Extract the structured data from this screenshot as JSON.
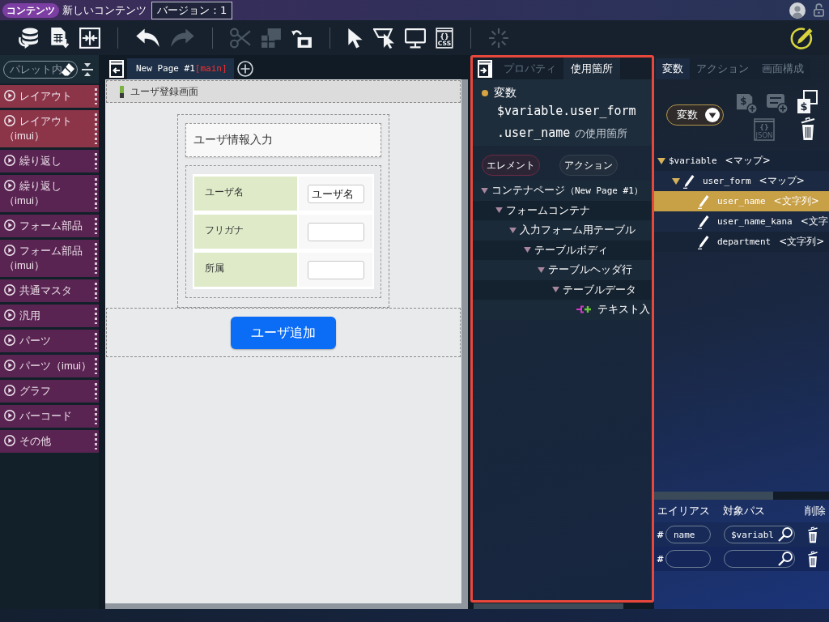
{
  "top_bar": {
    "badge": "コンテンツ",
    "title": "新しいコンテンツ",
    "version": "バージョン：1"
  },
  "toolbar": {
    "groups": [
      [
        {
          "kind": "database",
          "disabled": false
        },
        {
          "kind": "document",
          "disabled": false
        },
        {
          "kind": "split",
          "disabled": false
        }
      ],
      [
        {
          "kind": "undo",
          "disabled": false
        },
        {
          "kind": "redo",
          "disabled": true
        }
      ],
      [
        {
          "kind": "cut",
          "disabled": true
        },
        {
          "kind": "copy",
          "disabled": true
        },
        {
          "kind": "paste",
          "disabled": false
        }
      ],
      [
        {
          "kind": "pointer",
          "disabled": false
        },
        {
          "kind": "area",
          "disabled": false
        },
        {
          "kind": "preview",
          "disabled": false
        },
        {
          "kind": "css",
          "disabled": false,
          "symbol": "{}",
          "text": "CSS"
        }
      ],
      [
        {
          "kind": "spark",
          "disabled": true
        }
      ]
    ]
  },
  "palette": {
    "search": {
      "placeholder": "パレット内"
    },
    "categories": [
      {
        "label": "レイアウト",
        "color": "#8c3448"
      },
      {
        "label": "レイアウト（imui）",
        "color": "#8c3448"
      },
      {
        "label": "繰り返し",
        "color": "#5a2452"
      },
      {
        "label": "繰り返し（imui）",
        "color": "#5a2452"
      },
      {
        "label": "フォーム部品",
        "color": "#5a2452"
      },
      {
        "label": "フォーム部品（imui）",
        "color": "#5a2452"
      },
      {
        "label": "共通マスタ",
        "color": "#5a2452"
      },
      {
        "label": "汎用",
        "color": "#5a2452"
      },
      {
        "label": "パーツ",
        "color": "#5a2452"
      },
      {
        "label": "パーツ（imui）",
        "color": "#5a2452"
      },
      {
        "label": "グラフ",
        "color": "#5a2452"
      },
      {
        "label": "バーコード",
        "color": "#5a2452"
      },
      {
        "label": "その他",
        "color": "#5a2452"
      }
    ]
  },
  "canvas": {
    "tabs": [
      {
        "label": "New Page #1",
        "branch": "[main]",
        "selected": true
      }
    ],
    "page_title": "ユーザ登録画面",
    "form": {
      "title": "ユーザ情報入力",
      "rows": [
        {
          "label": "ユーザ名",
          "value": "ユーザ名"
        },
        {
          "label": "フリガナ"
        },
        {
          "label": "所属"
        }
      ]
    },
    "button": "ユーザ追加"
  },
  "usage_panel": {
    "tabs": [
      {
        "label": "プロパティ",
        "selected": false
      },
      {
        "label": "使用箇所",
        "selected": true
      }
    ],
    "target_kind": "変数",
    "path_lines": [
      "$variable.user_form",
      ".user_name"
    ],
    "suffix": "の使用箇所",
    "filters": [
      {
        "label": "エレメント",
        "selected": true
      },
      {
        "label": "アクション",
        "selected": false
      }
    ],
    "tree": [
      {
        "label": "コンテナページ",
        "note": "（New Page #1）",
        "expanded": true,
        "children": [
          {
            "label": "フォームコンテナ",
            "expanded": true,
            "children": [
              {
                "label": "入力フォーム用テーブル",
                "expanded": true,
                "children": [
                  {
                    "label": "テーブルボディ",
                    "expanded": true,
                    "children": [
                      {
                        "label": "テーブルヘッダ行",
                        "expanded": true,
                        "children": [
                          {
                            "label": "テーブルデータ",
                            "expanded": true,
                            "children": [
                              {
                                "label": "テキスト入"
                              }
                            ]
                          }
                        ]
                      }
                    ]
                  }
                ]
              }
            ]
          }
        ]
      }
    ]
  },
  "variables_panel": {
    "tabs": [
      {
        "label": "変数",
        "selected": true
      },
      {
        "label": "アクション",
        "selected": false
      },
      {
        "label": "画面構成",
        "selected": false
      }
    ],
    "scope": "変数",
    "actions": [
      {
        "kind": "add-variable",
        "disabled": true,
        "symbol": "$"
      },
      {
        "kind": "add-record",
        "disabled": true
      },
      {
        "kind": "copy-variable",
        "disabled": false,
        "symbol": "$"
      },
      {
        "kind": "json",
        "disabled": true,
        "symbol": "{}",
        "text": "JSON"
      },
      {
        "kind": "delete",
        "disabled": false
      }
    ],
    "tree": [
      {
        "name": "$variable",
        "type": "<マップ>",
        "selected": false,
        "expanded": true,
        "children": [
          {
            "name": "user_form",
            "type": "<マップ>",
            "selected": false,
            "expanded": true,
            "children": [
              {
                "name": "user_name",
                "type": "<文字列>",
                "selected": true
              },
              {
                "name": "user_name_kana",
                "type": "<文字",
                "selected": false
              },
              {
                "name": "department",
                "type": "<文字列>",
                "selected": false
              }
            ]
          }
        ]
      }
    ],
    "aliases": {
      "columns": [
        "エイリアス",
        "対象パス",
        "削除"
      ],
      "rows": [
        {
          "mark": "#",
          "alias": "name",
          "path": "$variabl"
        },
        {
          "mark": "#"
        }
      ]
    }
  }
}
